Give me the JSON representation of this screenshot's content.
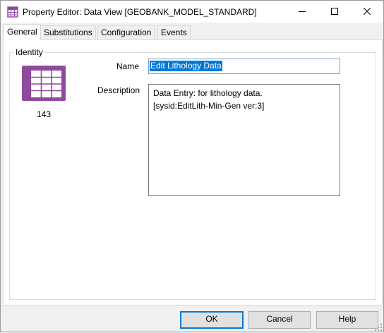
{
  "window": {
    "title": "Property Editor: Data View [GEOBANK_MODEL_STANDARD]",
    "icon": "table-icon",
    "controls": {
      "minimize": "minimize-icon",
      "maximize": "maximize-icon",
      "close": "close-icon"
    }
  },
  "tabs": [
    {
      "label": "General",
      "active": true
    },
    {
      "label": "Substitutions",
      "active": false
    },
    {
      "label": "Configuration",
      "active": false
    },
    {
      "label": "Events",
      "active": false
    }
  ],
  "identity": {
    "group_label": "Identity",
    "icon": "table-icon",
    "icon_color": "#8e4a9c",
    "id_number": "143",
    "name_label": "Name",
    "name_value": "Edit Lithology Data",
    "description_label": "Description",
    "description_lines": [
      "Data Entry: for lithology data.",
      "[sysid:EditLith-Min-Gen ver:3]"
    ]
  },
  "buttons": {
    "ok": "OK",
    "cancel": "Cancel",
    "help": "Help"
  },
  "colors": {
    "accent": "#0078d7",
    "selection": "#0078d7"
  }
}
